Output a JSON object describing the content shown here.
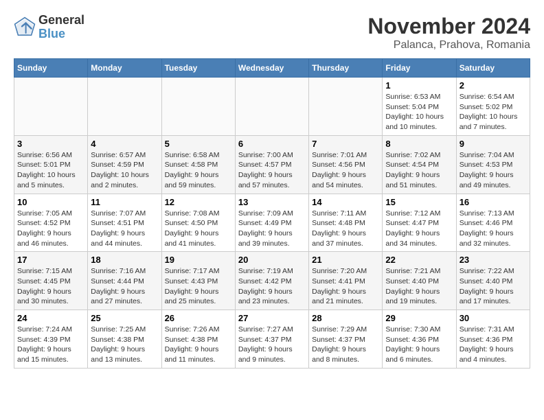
{
  "header": {
    "logo_text_general": "General",
    "logo_text_blue": "Blue",
    "month_title": "November 2024",
    "location": "Palanca, Prahova, Romania"
  },
  "days_of_week": [
    "Sunday",
    "Monday",
    "Tuesday",
    "Wednesday",
    "Thursday",
    "Friday",
    "Saturday"
  ],
  "weeks": [
    [
      {
        "day": "",
        "info": ""
      },
      {
        "day": "",
        "info": ""
      },
      {
        "day": "",
        "info": ""
      },
      {
        "day": "",
        "info": ""
      },
      {
        "day": "",
        "info": ""
      },
      {
        "day": "1",
        "info": "Sunrise: 6:53 AM\nSunset: 5:04 PM\nDaylight: 10 hours and 10 minutes."
      },
      {
        "day": "2",
        "info": "Sunrise: 6:54 AM\nSunset: 5:02 PM\nDaylight: 10 hours and 7 minutes."
      }
    ],
    [
      {
        "day": "3",
        "info": "Sunrise: 6:56 AM\nSunset: 5:01 PM\nDaylight: 10 hours and 5 minutes."
      },
      {
        "day": "4",
        "info": "Sunrise: 6:57 AM\nSunset: 4:59 PM\nDaylight: 10 hours and 2 minutes."
      },
      {
        "day": "5",
        "info": "Sunrise: 6:58 AM\nSunset: 4:58 PM\nDaylight: 9 hours and 59 minutes."
      },
      {
        "day": "6",
        "info": "Sunrise: 7:00 AM\nSunset: 4:57 PM\nDaylight: 9 hours and 57 minutes."
      },
      {
        "day": "7",
        "info": "Sunrise: 7:01 AM\nSunset: 4:56 PM\nDaylight: 9 hours and 54 minutes."
      },
      {
        "day": "8",
        "info": "Sunrise: 7:02 AM\nSunset: 4:54 PM\nDaylight: 9 hours and 51 minutes."
      },
      {
        "day": "9",
        "info": "Sunrise: 7:04 AM\nSunset: 4:53 PM\nDaylight: 9 hours and 49 minutes."
      }
    ],
    [
      {
        "day": "10",
        "info": "Sunrise: 7:05 AM\nSunset: 4:52 PM\nDaylight: 9 hours and 46 minutes."
      },
      {
        "day": "11",
        "info": "Sunrise: 7:07 AM\nSunset: 4:51 PM\nDaylight: 9 hours and 44 minutes."
      },
      {
        "day": "12",
        "info": "Sunrise: 7:08 AM\nSunset: 4:50 PM\nDaylight: 9 hours and 41 minutes."
      },
      {
        "day": "13",
        "info": "Sunrise: 7:09 AM\nSunset: 4:49 PM\nDaylight: 9 hours and 39 minutes."
      },
      {
        "day": "14",
        "info": "Sunrise: 7:11 AM\nSunset: 4:48 PM\nDaylight: 9 hours and 37 minutes."
      },
      {
        "day": "15",
        "info": "Sunrise: 7:12 AM\nSunset: 4:47 PM\nDaylight: 9 hours and 34 minutes."
      },
      {
        "day": "16",
        "info": "Sunrise: 7:13 AM\nSunset: 4:46 PM\nDaylight: 9 hours and 32 minutes."
      }
    ],
    [
      {
        "day": "17",
        "info": "Sunrise: 7:15 AM\nSunset: 4:45 PM\nDaylight: 9 hours and 30 minutes."
      },
      {
        "day": "18",
        "info": "Sunrise: 7:16 AM\nSunset: 4:44 PM\nDaylight: 9 hours and 27 minutes."
      },
      {
        "day": "19",
        "info": "Sunrise: 7:17 AM\nSunset: 4:43 PM\nDaylight: 9 hours and 25 minutes."
      },
      {
        "day": "20",
        "info": "Sunrise: 7:19 AM\nSunset: 4:42 PM\nDaylight: 9 hours and 23 minutes."
      },
      {
        "day": "21",
        "info": "Sunrise: 7:20 AM\nSunset: 4:41 PM\nDaylight: 9 hours and 21 minutes."
      },
      {
        "day": "22",
        "info": "Sunrise: 7:21 AM\nSunset: 4:40 PM\nDaylight: 9 hours and 19 minutes."
      },
      {
        "day": "23",
        "info": "Sunrise: 7:22 AM\nSunset: 4:40 PM\nDaylight: 9 hours and 17 minutes."
      }
    ],
    [
      {
        "day": "24",
        "info": "Sunrise: 7:24 AM\nSunset: 4:39 PM\nDaylight: 9 hours and 15 minutes."
      },
      {
        "day": "25",
        "info": "Sunrise: 7:25 AM\nSunset: 4:38 PM\nDaylight: 9 hours and 13 minutes."
      },
      {
        "day": "26",
        "info": "Sunrise: 7:26 AM\nSunset: 4:38 PM\nDaylight: 9 hours and 11 minutes."
      },
      {
        "day": "27",
        "info": "Sunrise: 7:27 AM\nSunset: 4:37 PM\nDaylight: 9 hours and 9 minutes."
      },
      {
        "day": "28",
        "info": "Sunrise: 7:29 AM\nSunset: 4:37 PM\nDaylight: 9 hours and 8 minutes."
      },
      {
        "day": "29",
        "info": "Sunrise: 7:30 AM\nSunset: 4:36 PM\nDaylight: 9 hours and 6 minutes."
      },
      {
        "day": "30",
        "info": "Sunrise: 7:31 AM\nSunset: 4:36 PM\nDaylight: 9 hours and 4 minutes."
      }
    ]
  ]
}
